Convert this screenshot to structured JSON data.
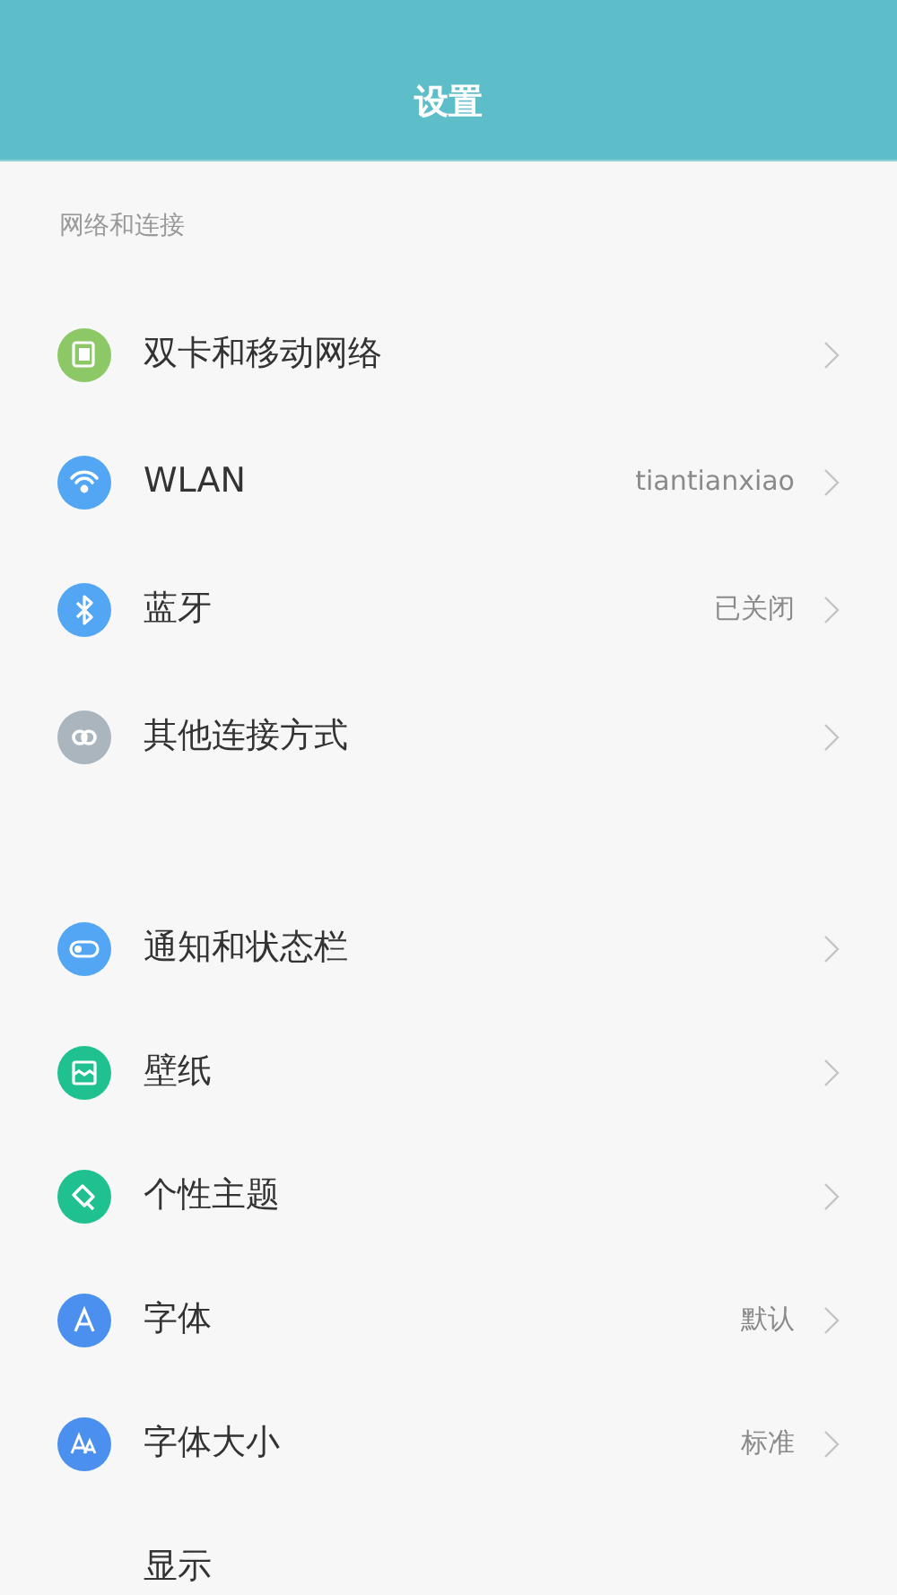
{
  "header": {
    "title": "设置"
  },
  "sections": [
    {
      "title": "网络和连接",
      "items": [
        {
          "label": "双卡和移动网络",
          "color": "#8cc866"
        },
        {
          "label": "WLAN",
          "value": "tiantianxiao",
          "color": "#52a6f4"
        },
        {
          "label": "蓝牙",
          "value": "已关闭",
          "color": "#52a6f4"
        },
        {
          "label": "其他连接方式",
          "color": "#abb5be"
        }
      ]
    },
    {
      "items": [
        {
          "label": "通知和状态栏",
          "color": "#52a6f4"
        },
        {
          "label": "壁纸",
          "color": "#1ec18f"
        },
        {
          "label": "个性主题",
          "color": "#1ec18f"
        },
        {
          "label": "字体",
          "value": "默认",
          "color": "#4b90ef"
        },
        {
          "label": "字体大小",
          "value": "标准",
          "color": "#4b90ef"
        },
        {
          "label": "显示"
        }
      ]
    }
  ]
}
